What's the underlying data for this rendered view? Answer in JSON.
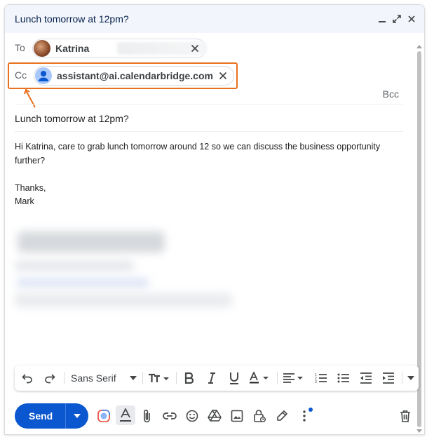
{
  "compose": {
    "title": "Lunch tomorrow at 12pm?",
    "to_label": "To",
    "cc_label": "Cc",
    "bcc_label": "Bcc",
    "to_recipient": {
      "name": "Katrina"
    },
    "cc_recipient": {
      "email": "assistant@ai.calendarbridge.com"
    },
    "subject": "Lunch tomorrow at 12pm?",
    "body": {
      "line1": "Hi Katrina, care to grab lunch tomorrow around 12 so we can discuss the business opportunity further?",
      "line2": "Thanks,",
      "line3": "Mark"
    }
  },
  "format_bar": {
    "font": "Sans Serif"
  },
  "bottom_bar": {
    "send_label": "Send"
  },
  "colors": {
    "accent": "#0b57d0",
    "highlight": "#e8711f",
    "title_bg": "#f2f6fc"
  },
  "icons": [
    "minimize-icon",
    "popout-icon",
    "close-icon",
    "undo-icon",
    "redo-icon",
    "text-size-icon",
    "bold-icon",
    "italic-icon",
    "underline-icon",
    "text-color-icon",
    "align-icon",
    "numbered-list-icon",
    "bulleted-list-icon",
    "indent-less-icon",
    "indent-more-icon",
    "more-formatting-icon",
    "ai-icon",
    "formatting-options-icon",
    "attach-icon",
    "link-icon",
    "emoji-icon",
    "drive-icon",
    "photo-icon",
    "confidential-icon",
    "signature-icon",
    "more-options-icon",
    "trash-icon"
  ]
}
